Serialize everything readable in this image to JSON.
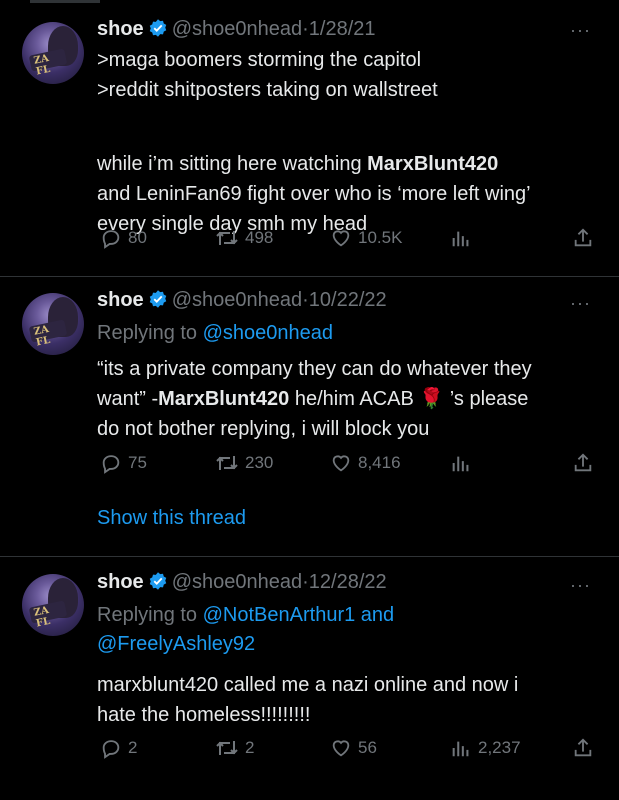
{
  "tweets": [
    {
      "name": "shoe",
      "handle": "@shoe0nhead",
      "separator": "·",
      "date": "1/28/21",
      "lines": [
        ">maga boomers storming the capitol",
        ">reddit shitposters taking on wallstreet",
        "",
        "while i’m sitting here watching ",
        "MarxBlunt420",
        "and LeninFan69 fight over who is ‘more left wing’",
        "every single day smh my head"
      ],
      "replies": "80",
      "retweets": "498",
      "likes": "10.5K",
      "views": ""
    },
    {
      "name": "shoe",
      "handle": "@shoe0nhead",
      "separator": "·",
      "date": "10/22/22",
      "replying_prefix": "Replying to ",
      "replying_to": "@shoe0nhead",
      "line1": "“its a private company they can do whatever they",
      "line2_a": "want” -",
      "line2_b": "MarxBlunt420",
      "line2_c": " he/him ACAB ",
      "line2_emoji": "🌹",
      "line2_d": " ’s please",
      "line3": "do not bother replying, i will block you",
      "replies": "75",
      "retweets": "230",
      "likes": "8,416",
      "views": "",
      "show_thread": "Show this thread"
    },
    {
      "name": "shoe",
      "handle": "@shoe0nhead",
      "separator": "·",
      "date": "12/28/22",
      "replying_prefix": "Replying to ",
      "replying_to_1": "@NotBenArthur1",
      "replying_and": " and",
      "replying_to_2": "@FreelyAshley92",
      "line1": "marxblunt420 called me a nazi online and now i",
      "line2": "hate the homeless!!!!!!!!!",
      "replies": "2",
      "retweets": "2",
      "likes": "56",
      "views": "2,237"
    }
  ],
  "more_glyph": "···",
  "colors": {
    "background": "#000000",
    "text": "#e7e9ea",
    "muted": "#71767b",
    "link": "#1d9bf0",
    "verified": "#1d9bf0"
  }
}
